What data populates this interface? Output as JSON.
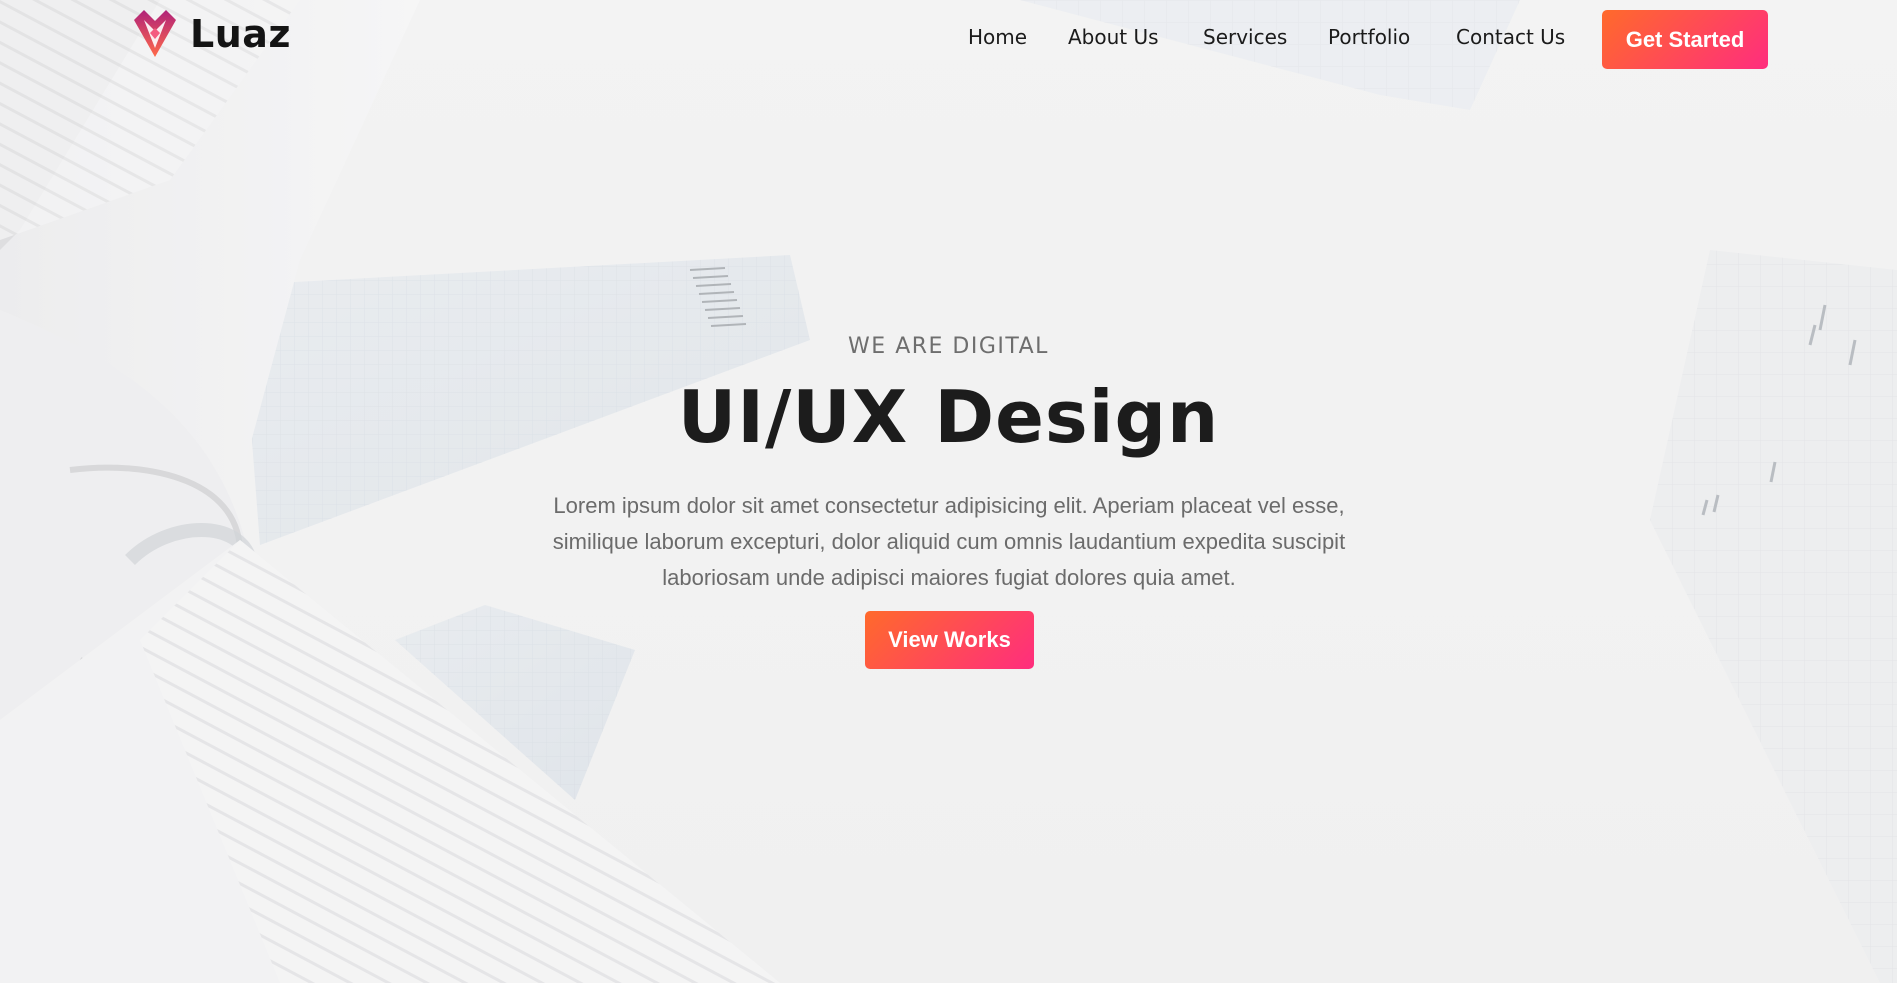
{
  "brand": {
    "name": "Luaz",
    "logo_icon": "heart-diamond-logo-icon",
    "gradient_start": "#ff6a2b",
    "gradient_end": "#ff2d7e",
    "logo_purple": "#b0227a"
  },
  "nav": {
    "items": [
      {
        "label": "Home"
      },
      {
        "label": "About Us"
      },
      {
        "label": "Services"
      },
      {
        "label": "Portfolio"
      },
      {
        "label": "Contact Us"
      }
    ],
    "cta_label": "Get Started"
  },
  "hero": {
    "eyebrow": "WE ARE DIGITAL",
    "title": "UI/UX Design",
    "description": "Lorem ipsum dolor sit amet consectetur adipisicing elit. Aperiam placeat vel esse, similique laborum excepturi, dolor aliquid cum omnis laudantium expedita suscipit laboriosam unde adipisci maiores fugiat dolores quia amet.",
    "button_label": "View Works"
  }
}
